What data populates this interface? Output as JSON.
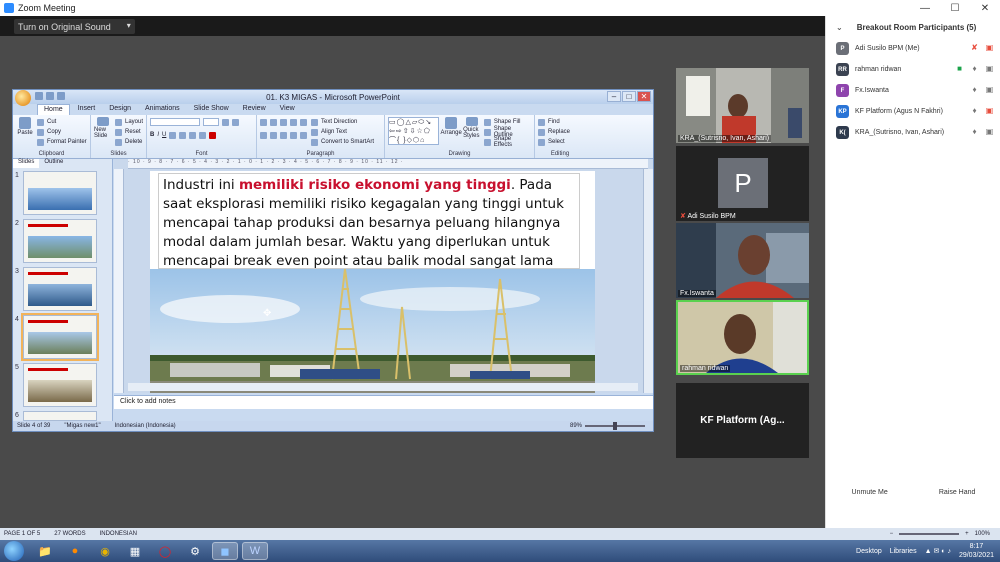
{
  "window": {
    "title": "Zoom Meeting"
  },
  "share": {
    "original_sound_label": "Turn on Original Sound"
  },
  "ppt": {
    "title": "01. K3  MIGAS - Microsoft PowerPoint",
    "tabs": [
      "Home",
      "Insert",
      "Design",
      "Animations",
      "Slide Show",
      "Review",
      "View"
    ],
    "clipboard": {
      "paste": "Paste",
      "cut": "Cut",
      "copy": "Copy",
      "format_painter": "Format Painter",
      "label": "Clipboard"
    },
    "slides_group": {
      "new_slide": "New Slide",
      "layout": "Layout",
      "reset": "Reset",
      "delete": "Delete",
      "label": "Slides"
    },
    "font_label": "Font",
    "paragraph": {
      "text_direction": "Text Direction",
      "align_text": "Align Text",
      "smartart": "Convert to SmartArt",
      "label": "Paragraph"
    },
    "drawing": {
      "arrange": "Arrange",
      "quick_styles": "Quick Styles",
      "fill": "Shape Fill",
      "outline": "Shape Outline",
      "effects": "Shape Effects",
      "label": "Drawing"
    },
    "editing": {
      "find": "Find",
      "replace": "Replace",
      "select": "Select",
      "label": "Editing"
    },
    "pane_tabs": [
      "Slides",
      "Outline"
    ],
    "thumbs": [
      "1",
      "2",
      "3",
      "4",
      "5",
      "6"
    ],
    "slide": {
      "text_before": "Industri ini ",
      "text_highlight": "memiliki risiko ekonomi yang tinggi",
      "text_after": ". Pada saat eksplorasi memiliki risiko kegagalan yang tinggi untuk mencapai tahap produksi dan besarnya peluang hilangnya modal dalam jumlah besar. Waktu yang diperlukan untuk mencapai break even point atau balik modal sangat lama"
    },
    "notes_placeholder": "Click to add notes",
    "status": {
      "slide_of": "Slide 4 of 39",
      "theme": "\"Migas new1\"",
      "language": "Indonesian (Indonesia)",
      "zoom": "89%"
    }
  },
  "videos": [
    {
      "name": "KRA_(Sutrisno, Ivan, Ashari)"
    },
    {
      "name": "Adi Susilo BPM",
      "initial": "P"
    },
    {
      "name": "Fx.Iswanta"
    },
    {
      "name": "rahman ridwan"
    },
    {
      "name": "KF Platform  (Ag..."
    }
  ],
  "panel": {
    "title": "Breakout Room Participants (5)",
    "participants": [
      {
        "initials": "P",
        "name": "Adi Susilo BPM (Me)",
        "color": "#6b6f77"
      },
      {
        "initials": "RR",
        "name": "rahman ridwan",
        "color": "#3b4352"
      },
      {
        "initials": "F",
        "name": "Fx.Iswanta",
        "color": "#8e44ad"
      },
      {
        "initials": "KP",
        "name": "KF Platform (Agus N Fakhri)",
        "color": "#2a74d6"
      },
      {
        "initials": "K(",
        "name": "KRA_(Sutrisno, Ivan, Ashari)",
        "color": "#2e3a4d"
      }
    ],
    "unmute_label": "Unmute Me",
    "raise_label": "Raise Hand"
  },
  "word_status": {
    "page": "PAGE 1 OF 5",
    "words": "27 WORDS",
    "lang": "INDONESIAN",
    "zoom": "100%"
  },
  "taskbar": {
    "desktop": "Desktop",
    "libraries": "Libraries",
    "time": "8:17",
    "date": "29/03/2021"
  }
}
